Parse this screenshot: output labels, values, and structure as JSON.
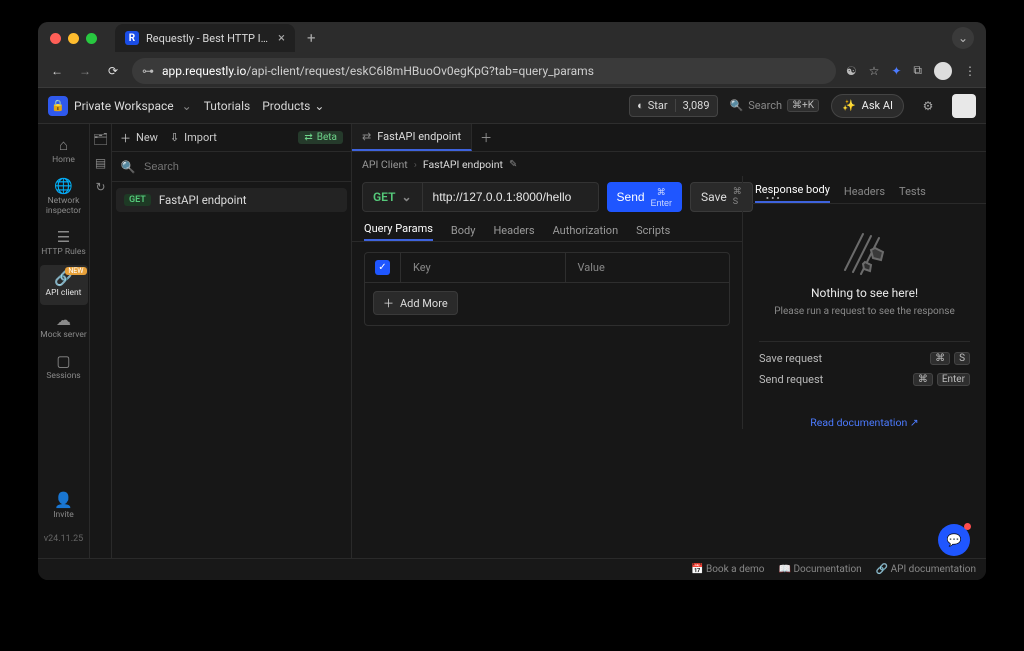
{
  "browser": {
    "tab_title": "Requestly - Best HTTP Interc",
    "url_domain": "app.requestly.io",
    "url_path": "/api-client/request/eskC6l8mHBuoOv0egKpG?tab=query_params"
  },
  "top": {
    "workspace": "Private Workspace",
    "tutorials": "Tutorials",
    "products": "Products",
    "github_star": "Star",
    "github_count": "3,089",
    "search_label": "Search",
    "search_kbd": "⌘+K",
    "ask_ai": "Ask AI"
  },
  "rail": {
    "home": "Home",
    "network": "Network inspector",
    "rules": "HTTP Rules",
    "api_client": "API client",
    "mock": "Mock server",
    "sessions": "Sessions",
    "invite": "Invite",
    "new_badge": "NEW"
  },
  "sidebar": {
    "new": "New",
    "import": "Import",
    "beta": "Beta",
    "search_placeholder": "Search",
    "request_method": "GET",
    "request_name": "FastAPI endpoint"
  },
  "main": {
    "tab_label": "FastAPI endpoint",
    "crumb_root": "API Client",
    "crumb_leaf": "FastAPI endpoint",
    "method": "GET",
    "url": "http://127.0.0.1:8000/hello",
    "send": "Send",
    "send_hint": "⌘ Enter",
    "save": "Save",
    "save_hint": "⌘ S",
    "subtabs": {
      "query": "Query Params",
      "body": "Body",
      "headers": "Headers",
      "auth": "Authorization",
      "scripts": "Scripts"
    },
    "key_col": "Key",
    "value_col": "Value",
    "add_more": "Add More"
  },
  "right": {
    "tabs": {
      "body": "Response body",
      "headers": "Headers",
      "tests": "Tests"
    },
    "empty_title": "Nothing to see here!",
    "empty_sub": "Please run a request to see the response",
    "save_request": "Save request",
    "send_request": "Send request",
    "kbd_cmd": "⌘",
    "kbd_s": "S",
    "kbd_enter": "Enter",
    "doc_link": "Read documentation"
  },
  "footer": {
    "version": "v24.11.25",
    "book_demo": "Book a demo",
    "documentation": "Documentation",
    "api_documentation": "API documentation"
  }
}
